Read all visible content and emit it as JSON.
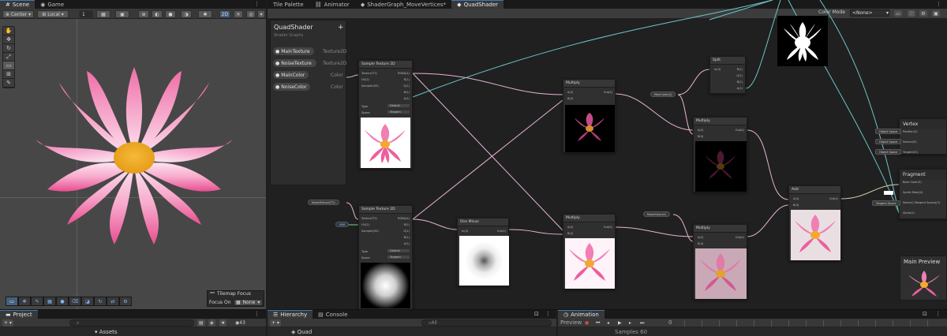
{
  "scene": {
    "tabs": [
      {
        "label": "Scene",
        "icon": "hash-icon"
      },
      {
        "label": "Game",
        "icon": "gamepad-icon"
      }
    ],
    "toolbar": {
      "pivot_mode": "Center",
      "pivot_space": "Local",
      "grid_value": "1",
      "mode_2d": "2D"
    },
    "tools": [
      "view-tool",
      "move-tool",
      "rotate-tool",
      "scale-tool",
      "rect-tool",
      "transform-tool",
      "custom-tool"
    ],
    "tilemap_focus": {
      "title": "Tilemap Focus",
      "label": "Focus On",
      "value": "None"
    },
    "accent_color": "#3a79bb"
  },
  "graph": {
    "tabs": [
      {
        "label": "Tile Palette"
      },
      {
        "label": "Animator"
      },
      {
        "label": "ShaderGraph_MoveVertices*"
      },
      {
        "label": "QuadShader"
      }
    ],
    "color_mode_label": "Color Mode",
    "color_mode_value": "<None>",
    "blackboard": {
      "title": "QuadShader",
      "subtitle": "Shader Graphs",
      "properties": [
        {
          "name": "MainTexture",
          "type": "Texture2D"
        },
        {
          "name": "NoiseTexture",
          "type": "Texture2D"
        },
        {
          "name": "MainColor",
          "type": "Color"
        },
        {
          "name": "NoiseColor",
          "type": "Color"
        }
      ]
    },
    "nodes": {
      "sample1": {
        "title": "Sample Texture 2D",
        "inputs": [
          "Texture(T2)",
          "UV(2)",
          "Sampler(SS)"
        ],
        "outputs": [
          "RGBA(4)",
          "R(1)",
          "G(1)",
          "B(1)",
          "A(1)"
        ],
        "type_label": "Type",
        "type_value": "Default",
        "space_label": "Space",
        "space_value": "Tangent"
      },
      "sample2": {
        "title": "Sample Texture 2D",
        "inputs": [
          "Texture(T2)",
          "UV(2)",
          "Sampler(SS)"
        ],
        "outputs": [
          "RGBA(4)",
          "R(1)",
          "G(1)",
          "B(1)",
          "A(1)"
        ],
        "type_label": "Type",
        "type_value": "Default",
        "space_label": "Space",
        "space_value": "Tangent",
        "uv_pill": "UV0"
      },
      "multiply1": {
        "title": "Multiply",
        "inputs": [
          "A(4)",
          "B(4)"
        ],
        "output": "Out(4)"
      },
      "multiply2": {
        "title": "Multiply",
        "inputs": [
          "A(4)",
          "B(4)"
        ],
        "output": "Out(4)"
      },
      "multiply3": {
        "title": "Multiply",
        "inputs": [
          "A(4)",
          "B(4)"
        ],
        "output": "Out(4)"
      },
      "multiply4": {
        "title": "Multiply",
        "inputs": [
          "A(4)",
          "B(4)"
        ],
        "output": "Out(4)"
      },
      "one_minus": {
        "title": "One Minus",
        "inputs": [
          "In(4)"
        ],
        "output": "Out(4)"
      },
      "split": {
        "title": "Split",
        "inputs": [
          "In(4)"
        ],
        "outputs": [
          "R(1)",
          "G(1)",
          "B(1)",
          "A(1)"
        ]
      },
      "add": {
        "title": "Add",
        "inputs": [
          "A(4)",
          "B(4)"
        ],
        "output": "Out(4)"
      }
    },
    "property_pills": {
      "main_texture": "MainTexture(T2)",
      "noise_texture": "NoiseTexture(T2)",
      "main_color": "MainColor(4)",
      "noise_color": "NoiseColor(4)"
    },
    "vertex": {
      "title": "Vertex",
      "ports": [
        "Position(3)",
        "Normal(3)",
        "Tangent(3)"
      ],
      "space": "Object Space"
    },
    "fragment": {
      "title": "Fragment",
      "ports": [
        "Base Color(3)",
        "Sprite Mask(4)",
        "Normal (Tangent Space)(3)",
        "Alpha(1)"
      ],
      "tangent_space": "Tangent Space"
    },
    "main_preview": "Main Preview"
  },
  "bottom": {
    "project": {
      "tab": "Project",
      "assets_label": "Assets",
      "count": "43"
    },
    "hierarchy": {
      "tab": "Hierarchy",
      "item": "Quad",
      "search_placeholder": "All"
    },
    "console": {
      "tab": "Console"
    },
    "animation": {
      "tab": "Animation",
      "preview": "Preview",
      "samples_label": "Samples",
      "samples_value": "60",
      "frame": "0"
    }
  }
}
